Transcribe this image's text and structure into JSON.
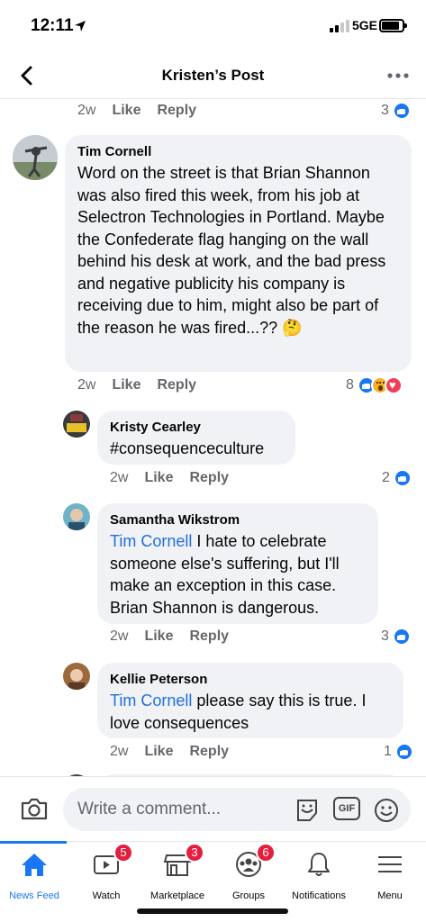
{
  "status": {
    "time": "12:11",
    "network": "5GE"
  },
  "header": {
    "title": "Kristen’s Post"
  },
  "top_comment_actions": {
    "time": "2w",
    "like": "Like",
    "reply": "Reply",
    "reaction_count": "3"
  },
  "comments": [
    {
      "author": "Tim Cornell",
      "text": "Word on the street is that Brian Shannon was also fired this week, from his job at Selectron Technologies in Portland. Maybe the Confederate flag hanging on the wall behind his desk at work, and the bad press and negative publicity his company is receiving due to him, might also be part of the reason he was fired...?? 🤔",
      "time": "2w",
      "like": "Like",
      "reply": "Reply",
      "reaction_count": "8"
    },
    {
      "author": "Kristy Cearley",
      "text": "#consequenceculture",
      "time": "2w",
      "like": "Like",
      "reply": "Reply",
      "reaction_count": "2"
    },
    {
      "author": "Samantha Wikstrom",
      "mention": "Tim Cornell",
      "text": " I hate to celebrate someone else's suffering, but I'll make an exception in this case. Brian Shannon is dangerous.",
      "time": "2w",
      "like": "Like",
      "reply": "Reply",
      "reaction_count": "3"
    },
    {
      "author": "Kellie Peterson",
      "mention": "Tim Cornell",
      "text": " please say this is true. I love consequences",
      "time": "2w",
      "like": "Like",
      "reply": "Reply",
      "reaction_count": "1"
    }
  ],
  "composer": {
    "placeholder": "Write a comment...",
    "gif_label": "GIF"
  },
  "tabs": [
    {
      "label": "News Feed",
      "icon": "home-icon",
      "badge": ""
    },
    {
      "label": "Watch",
      "icon": "video-icon",
      "badge": "5"
    },
    {
      "label": "Marketplace",
      "icon": "shop-icon",
      "badge": "3"
    },
    {
      "label": "Groups",
      "icon": "groups-icon",
      "badge": "6"
    },
    {
      "label": "Notifications",
      "icon": "bell-icon",
      "badge": ""
    },
    {
      "label": "Menu",
      "icon": "hamburger-icon",
      "badge": ""
    }
  ],
  "colors": {
    "accent": "#1877f2",
    "badge": "#e41e3f",
    "bubble": "#f0f2f5",
    "mention": "#216fdb"
  }
}
